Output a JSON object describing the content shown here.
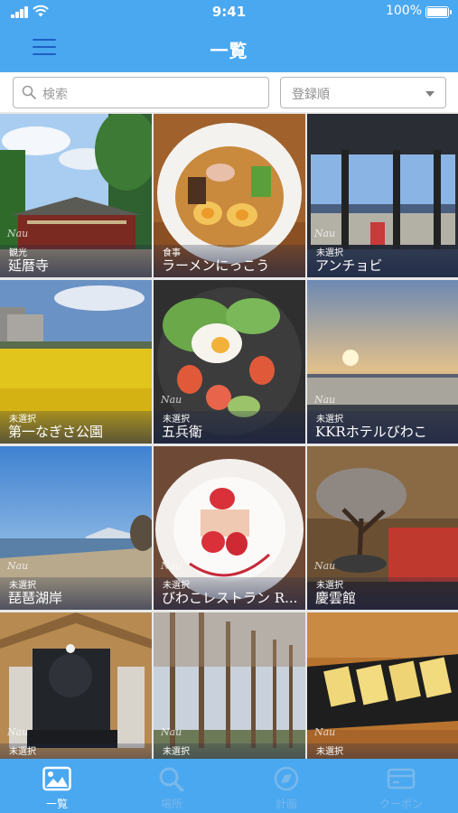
{
  "status_bar": {
    "time": "9:41",
    "battery": "100%"
  },
  "header": {
    "title": "一覧",
    "menu_icon": "hamburger-menu-icon"
  },
  "search": {
    "placeholder": "検索"
  },
  "sort": {
    "selected": "登録順"
  },
  "colors": {
    "accent": "#4aa8f0",
    "icon_dark": "#1e5fc4",
    "tab_active": "#ffffff",
    "tab_inactive": "#7ab8ea"
  },
  "items": [
    {
      "category": "観光",
      "name": "延暦寺",
      "mark": "Nau"
    },
    {
      "category": "食事",
      "name": "ラーメンにっこう",
      "mark": ""
    },
    {
      "category": "未選択",
      "name": "アンチョビ",
      "mark": "Nau"
    },
    {
      "category": "未選択",
      "name": "第一なぎさ公園",
      "mark": ""
    },
    {
      "category": "未選択",
      "name": "五兵衛",
      "mark": "Nau"
    },
    {
      "category": "未選択",
      "name": "KKRホテルびわこ",
      "mark": "Nau"
    },
    {
      "category": "未選択",
      "name": "琵琶湖岸",
      "mark": "Nau"
    },
    {
      "category": "未選択",
      "name": "びわこレストラン R...",
      "mark": "Nau"
    },
    {
      "category": "未選択",
      "name": "慶雲館",
      "mark": "Nau"
    },
    {
      "category": "未選択",
      "name": "",
      "mark": "Nau"
    },
    {
      "category": "未選択",
      "name": "",
      "mark": "Nau"
    },
    {
      "category": "未選択",
      "name": "",
      "mark": "Nau"
    }
  ],
  "tabs": [
    {
      "label": "一覧",
      "icon": "photo-icon",
      "active": true
    },
    {
      "label": "場所",
      "icon": "search-icon",
      "active": false
    },
    {
      "label": "計画",
      "icon": "compass-icon",
      "active": false
    },
    {
      "label": "クーポン",
      "icon": "coupon-card-icon",
      "active": false
    }
  ]
}
